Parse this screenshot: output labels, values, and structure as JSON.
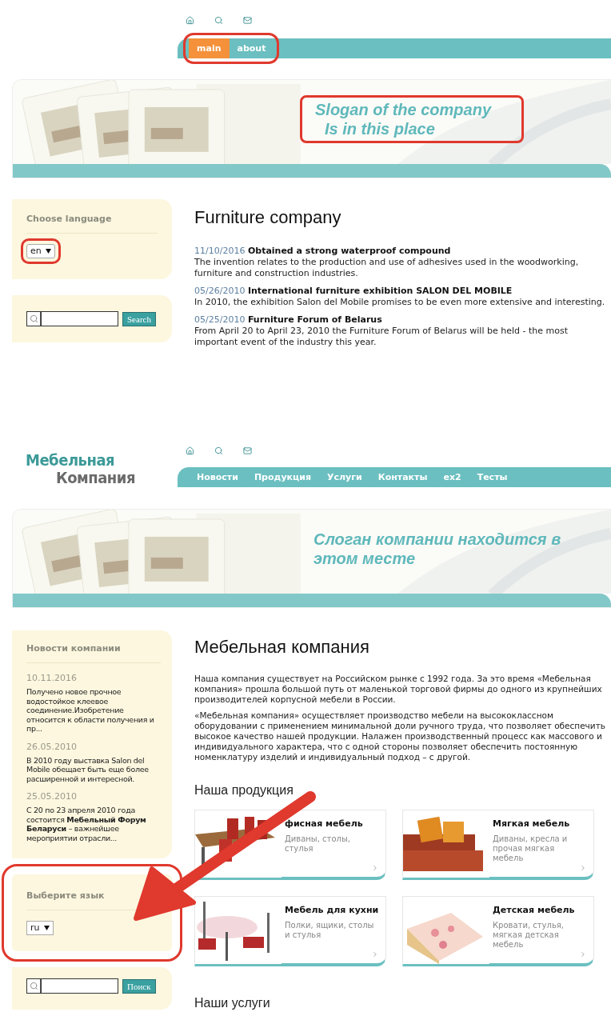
{
  "english_page": {
    "nav": {
      "highlighted": true,
      "tabs": [
        {
          "label": "main",
          "selected": true
        },
        {
          "label": "about",
          "selected": false
        }
      ]
    },
    "banner": {
      "slogan": [
        "Slogan of the company",
        "Is in this place"
      ],
      "highlighted": true
    },
    "language": {
      "title": "Choose language",
      "value": "en",
      "highlighted": true
    },
    "search": {
      "button": "Search"
    },
    "heading": "Furniture company",
    "news": [
      {
        "date": "11/10/2016",
        "title": "Obtained a strong waterproof compound",
        "text": "The invention relates to the production and use of adhesives used in the woodworking, furniture and construction industries."
      },
      {
        "date": "05/26/2010",
        "title": "International furniture exhibition SALON DEL MOBILE",
        "text": "In 2010, the exhibition Salon del Mobile promises to be even more extensive and interesting."
      },
      {
        "date": "05/25/2010",
        "title": "Furniture Forum of Belarus",
        "text": "From April 20 to April 23, 2010 the Furniture Forum of Belarus will be held - the most important event of the industry this year."
      }
    ]
  },
  "russian_page": {
    "logo": [
      "Мебельная",
      "Компания"
    ],
    "nav": {
      "tabs": [
        {
          "label": "Новости",
          "selected": false
        },
        {
          "label": "Продукция",
          "selected": false
        },
        {
          "label": "Услуги",
          "selected": false
        },
        {
          "label": "Контакты",
          "selected": false
        },
        {
          "label": "ex2",
          "selected": false
        },
        {
          "label": "Тесты",
          "selected": false
        }
      ]
    },
    "banner": {
      "slogan": [
        "Слоган компании находится в этом месте"
      ],
      "highlighted": false
    },
    "news_panel": {
      "title": "Новости компании",
      "items": [
        {
          "date": "10.11.2016",
          "text": "Получено новое прочное водостойкое клеевое соединение.Изобретение относится к области получения и пр..."
        },
        {
          "date": "26.05.2010",
          "text": "В 2010 году выставка Salon del Mobile обещает быть еще более расширенной и интересной."
        },
        {
          "date": "25.05.2010",
          "text": "С 20 по 23 апреля 2010 года состоится **Мебельный Форум Беларуси** – важнейшее мероприятии отрасли..."
        }
      ]
    },
    "language": {
      "title": "Выберите язык",
      "value": "ru",
      "highlighted": true
    },
    "search": {
      "button": "Поиск"
    },
    "heading": "Мебельная компания",
    "paragraphs": [
      "Наша компания существует на Российском рынке с 1992 года. За это время «Мебельная компания» прошла большой путь от маленькой торговой фирмы до одного из крупнейших производителей корпусной мебели в России.",
      "«Мебельная компания» осуществляет производство мебели на высококлассном оборудовании с применением минимальной доли ручного труда, что позволяет обеспечить высокое качество нашей продукции. Налажен производственный процесс как массового и индивидуального характера, что с одной стороны позволяет обеспечить постоянную номенклатуру изделий и индивидуальный подход – с другой."
    ],
    "products_heading": "Наша продукция",
    "products": [
      {
        "kind": "office",
        "title": "фисная мебель",
        "text": "Диваны, столы, стулья"
      },
      {
        "kind": "sofa",
        "title": "Мягкая мебель",
        "text": "Диваны, кресла и прочая мягкая мебель"
      },
      {
        "kind": "kitchen",
        "title": "Мебель для кухни",
        "text": "Полки, ящики, столы и стулья"
      },
      {
        "kind": "bed",
        "title": "Детская мебель",
        "text": "Кровати, стулья, мягкая детская мебель"
      }
    ],
    "services_heading": "Наши услуги",
    "arrow": true
  }
}
